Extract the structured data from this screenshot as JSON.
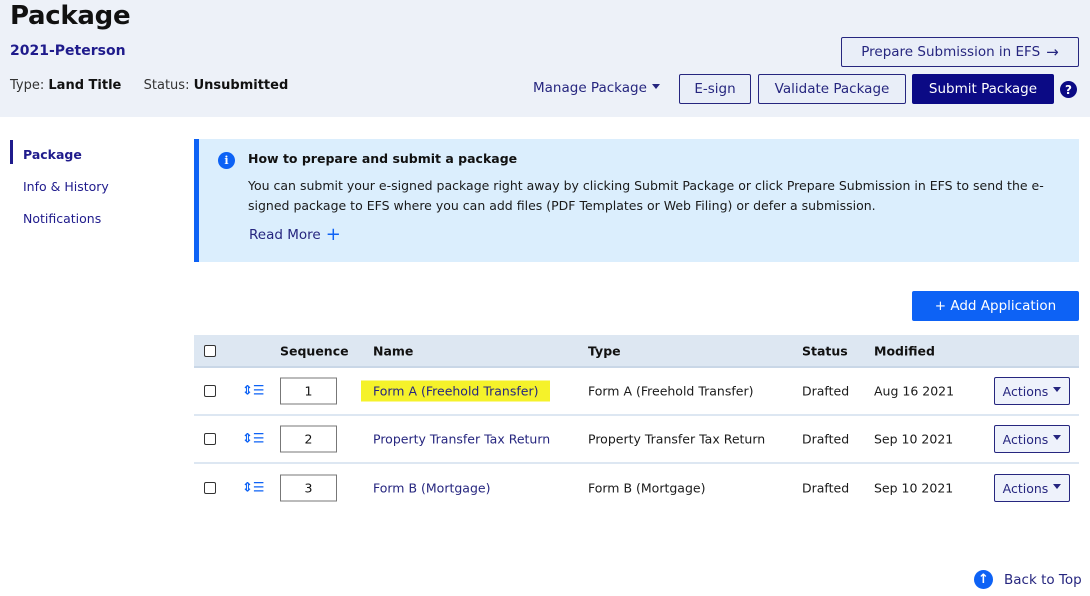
{
  "header": {
    "title": "Package",
    "package_name": "2021-Peterson",
    "type_label": "Type:",
    "type_value": "Land Title",
    "status_label": "Status:",
    "status_value": "Unsubmitted",
    "prepare_efs_label": "Prepare Submission in EFS",
    "prepare_efs_icon": "arrow-right-icon",
    "manage_package_label": "Manage Package",
    "esign_label": "E-sign",
    "validate_label": "Validate Package",
    "submit_label": "Submit Package",
    "help_glyph": "?",
    "colors": {
      "primary": "#0b0a85",
      "header_bg": "#edf1f8"
    }
  },
  "sidebar": {
    "items": [
      {
        "label": "Package",
        "active": true
      },
      {
        "label": "Info & History",
        "active": false
      },
      {
        "label": "Notifications",
        "active": false
      }
    ]
  },
  "info_panel": {
    "icon": "info-icon",
    "icon_glyph": "i",
    "title": "How to prepare and submit a package",
    "body": "You can submit your e-signed package right away by clicking Submit Package or click Prepare Submission in EFS to send the e-signed package to EFS where you can add files (PDF Templates or Web Filing) or defer a submission.",
    "read_more_label": "Read More",
    "read_more_glyph": "+",
    "colors": {
      "background": "#dbeefd",
      "accent": "#0d62f5"
    }
  },
  "add_application_label": "+ Add Application",
  "table": {
    "headers": {
      "sequence": "Sequence",
      "name": "Name",
      "type": "Type",
      "status": "Status",
      "modified": "Modified"
    },
    "rows": [
      {
        "sequence": "1",
        "name": "Form A (Freehold Transfer)",
        "type": "Form A (Freehold Transfer)",
        "status": "Drafted",
        "modified": "Aug 16 2021",
        "actions": "Actions",
        "highlighted": true
      },
      {
        "sequence": "2",
        "name": "Property Transfer Tax Return",
        "type": "Property Transfer Tax Return",
        "status": "Drafted",
        "modified": "Sep 10 2021",
        "actions": "Actions",
        "highlighted": false
      },
      {
        "sequence": "3",
        "name": "Form B (Mortgage)",
        "type": "Form B (Mortgage)",
        "status": "Drafted",
        "modified": "Sep 10 2021",
        "actions": "Actions",
        "highlighted": false
      }
    ],
    "reorder_glyph": "↕☰",
    "colors": {
      "highlight": "#f5f22a",
      "header_bg": "#dde7f2"
    }
  },
  "back_to_top_label": "Back to Top",
  "back_to_top_glyph": "↑"
}
